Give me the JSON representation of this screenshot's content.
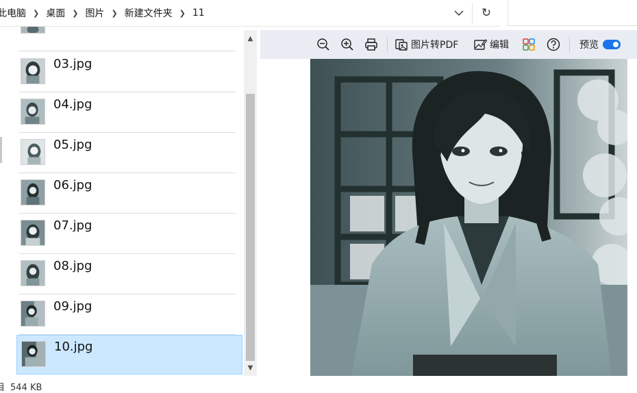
{
  "breadcrumb": [
    "此电脑",
    "桌面",
    "图片",
    "新建文件夹",
    "11"
  ],
  "search": {
    "placeholder": ""
  },
  "files": [
    {
      "name": "",
      "partial": true
    },
    {
      "name": "03.jpg"
    },
    {
      "name": "04.jpg"
    },
    {
      "name": "05.jpg"
    },
    {
      "name": "06.jpg"
    },
    {
      "name": "07.jpg"
    },
    {
      "name": "08.jpg"
    },
    {
      "name": "09.jpg"
    },
    {
      "name": "10.jpg",
      "selected": true
    }
  ],
  "status": {
    "lead": "目",
    "size": "544 KB"
  },
  "toolbar": {
    "pdf_label": "图片转PDF",
    "edit_label": "编辑",
    "preview_label": "预览"
  },
  "colors": {
    "selected_bg": "#cce8ff",
    "toggle": "#1a73e8",
    "toolbar_bg": "#e9ecf2"
  },
  "icons": [
    "zoom-out-icon",
    "zoom-in-icon",
    "print-icon",
    "pdf-icon",
    "edit-image-icon",
    "apps-icon",
    "help-icon",
    "toggle-switch"
  ]
}
